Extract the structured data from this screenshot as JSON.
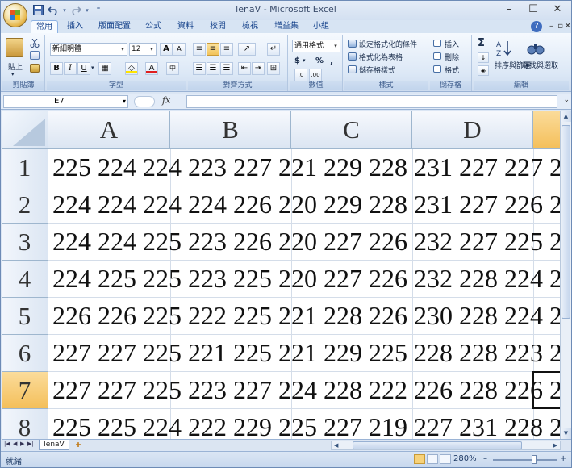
{
  "app": {
    "title": "lenaV - Microsoft Excel",
    "qat_icons": [
      "save-icon",
      "undo-icon",
      "redo-icon",
      "customize-icon"
    ]
  },
  "tabs": [
    "常用",
    "插入",
    "版面配置",
    "公式",
    "資料",
    "校閱",
    "檢視",
    "增益集",
    "小組"
  ],
  "help_label": "?",
  "ribbon": {
    "clipboard": {
      "label": "剪貼簿",
      "paste": "貼上"
    },
    "font": {
      "label": "字型",
      "font_name": "新細明體",
      "font_size": "12"
    },
    "alignment": {
      "label": "對齊方式"
    },
    "number": {
      "label": "數值",
      "format": "通用格式",
      "currency": "$",
      "percent": "%",
      "comma": ","
    },
    "styles": {
      "label": "樣式",
      "conditional": "設定格式化的條件",
      "as_table": "格式化為表格",
      "cell_styles": "儲存格樣式"
    },
    "cells": {
      "label": "儲存格",
      "insert": "插入",
      "delete": "刪除",
      "format": "格式"
    },
    "editing": {
      "label": "編輯",
      "sort": "排序與篩選",
      "find": "尋找與選取"
    }
  },
  "formula_bar": {
    "name_box": "E7",
    "fx": "fx",
    "formula": ""
  },
  "grid": {
    "columns": [
      "A",
      "B",
      "C",
      "D"
    ],
    "row_numbers": [
      "1",
      "2",
      "3",
      "4",
      "5",
      "6",
      "7",
      "8"
    ],
    "selected_cell": "E7",
    "rows": [
      "225 224 224 223 227 221 229 228 231 227 227 2",
      "224 224 224 224 226 220 229 228 231 227 226 2",
      "224 224 225 223 226 220 227 226 232 227 225 2",
      "224 225 225 223 225 220 227 226 232 228 224 2",
      "226 226 225 222 225 221 228 226 230 228 224 2",
      "227 227 225 221 225 221 229 225 228 228 223 2",
      "227 227 225 223 227 224 228 222 226 228 226 2",
      "225 225 224 222 229 225 227 219 227 231 228 2"
    ]
  },
  "sheets": [
    "lenaV"
  ],
  "status": {
    "ready": "就緒",
    "zoom": "280%"
  }
}
